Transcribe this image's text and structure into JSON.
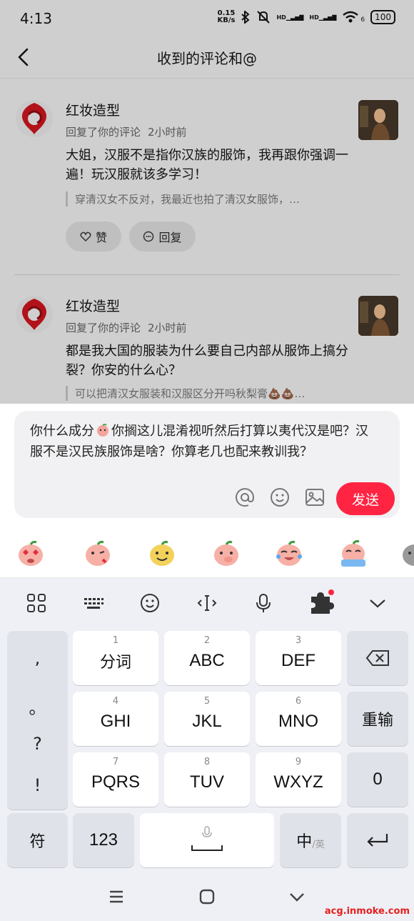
{
  "status_bar": {
    "time": "4:13",
    "speed_value": "0.15",
    "speed_unit": "KB/s",
    "hd1": "HD",
    "hd2": "HD",
    "wifi_sub": "6",
    "battery": "100"
  },
  "header": {
    "title": "收到的评论和@"
  },
  "comments": [
    {
      "user": "红妆造型",
      "action": "回复了你的评论",
      "time": "2小时前",
      "text": "大姐，汉服不是指你汉族的服饰，我再跟你强调一遍！玩汉服就该多学习！",
      "quote": "穿清汉女不反对，我最近也拍了清汉女服饰，…",
      "like_label": "赞",
      "reply_label": "回复"
    },
    {
      "user": "红妆造型",
      "action": "回复了你的评论",
      "time": "2小时前",
      "text": "都是我大国的服装为什么要自己内部从服饰上搞分裂？你安的什么心？",
      "quote": "可以把清汉女服装和汉服区分开吗秋梨膏💩💩…"
    }
  ],
  "compose": {
    "text_part1": "你什么成分",
    "text_part2": "你搁这儿混淆视听然后打算以夷代汉是吧？汉服不是汉民族服饰是啥？你算老几也配来教训我？",
    "send_label": "发送"
  },
  "keyboard": {
    "punct": [
      ",",
      "。",
      "?",
      "!"
    ],
    "keys": [
      {
        "num": "1",
        "label": "分词"
      },
      {
        "num": "2",
        "label": "ABC"
      },
      {
        "num": "3",
        "label": "DEF"
      },
      {
        "num": "4",
        "label": "GHI"
      },
      {
        "num": "5",
        "label": "JKL"
      },
      {
        "num": "6",
        "label": "MNO"
      },
      {
        "num": "7",
        "label": "PQRS"
      },
      {
        "num": "8",
        "label": "TUV"
      },
      {
        "num": "9",
        "label": "WXYZ"
      }
    ],
    "retype_label": "重输",
    "zero_label": "0",
    "symbol_label": "符",
    "num_label": "123",
    "lang_main": "中",
    "lang_sub": "/英"
  },
  "watermark": "acg.inmoke.com",
  "colors": {
    "accent": "#ff2442",
    "dim_overlay": "#cfcfcf",
    "keyboard_bg": "#eef0f5"
  }
}
